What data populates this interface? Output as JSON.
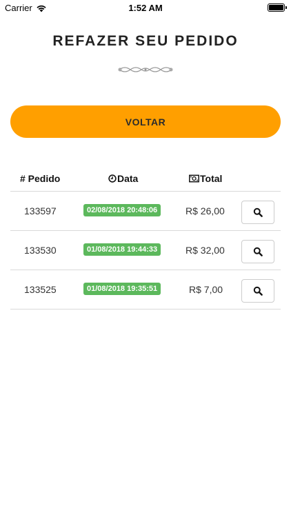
{
  "status_bar": {
    "carrier": "Carrier",
    "time": "1:52 AM"
  },
  "page": {
    "title": "REFAZER SEU PEDIDO",
    "back_button": "VOLTAR"
  },
  "table": {
    "headers": {
      "pedido": "# Pedido",
      "data": "Data",
      "total": "Total"
    },
    "rows": [
      {
        "id": "133597",
        "date": "02/08/2018 20:48:06",
        "total": "R$ 26,00"
      },
      {
        "id": "133530",
        "date": "01/08/2018 19:44:33",
        "total": "R$ 32,00"
      },
      {
        "id": "133525",
        "date": "01/08/2018 19:35:51",
        "total": "R$ 7,00"
      }
    ]
  },
  "colors": {
    "accent": "#ff9f00",
    "date_badge": "#5cb85c"
  },
  "icons": {
    "data_header": "clock-icon",
    "total_header": "money-icon",
    "row_action": "search-icon"
  }
}
